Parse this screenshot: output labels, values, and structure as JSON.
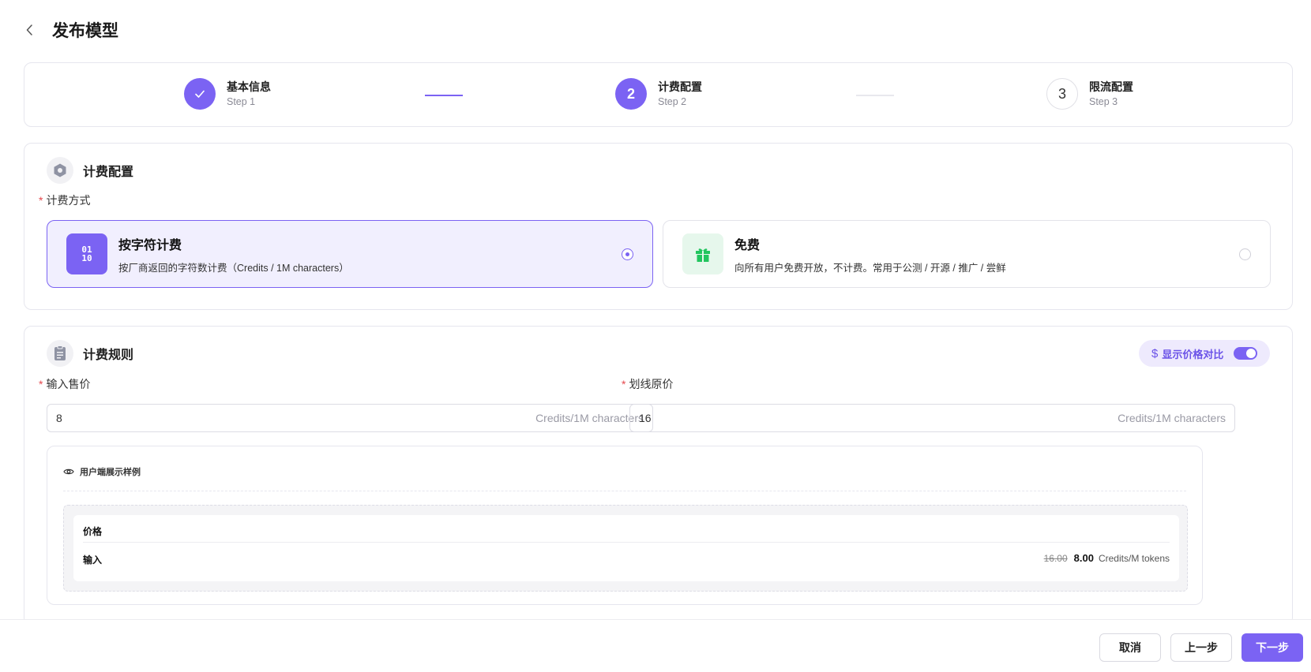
{
  "header": {
    "title": "发布模型"
  },
  "steps": [
    {
      "title": "基本信息",
      "sub": "Step 1",
      "state": "done"
    },
    {
      "title": "计费配置",
      "sub": "Step 2",
      "number": "2",
      "state": "active"
    },
    {
      "title": "限流配置",
      "sub": "Step 3",
      "number": "3",
      "state": "todo"
    }
  ],
  "billing": {
    "section_title": "计费配置",
    "method_label": "计费方式",
    "options": [
      {
        "icon_text": "01 10",
        "title": "按字符计费",
        "desc": "按厂商返回的字符数计费（Credits / 1M characters）",
        "selected": true
      },
      {
        "title": "免费",
        "desc": "向所有用户免费开放，不计费。常用于公测 / 开源 / 推广 / 尝鲜",
        "selected": false
      }
    ]
  },
  "rules": {
    "section_title": "计费规则",
    "toggle_label": "显示价格对比",
    "toggle_on": true,
    "input_price": {
      "label": "输入售价",
      "value": "8",
      "unit": "Credits/1M characters"
    },
    "original_price": {
      "label": "划线原价",
      "value": "16",
      "unit": "Credits/1M characters"
    },
    "preview": {
      "title": "用户端展示样例",
      "price_label": "价格",
      "row_label": "输入",
      "original": "16.00",
      "current": "8.00",
      "unit": "Credits/M tokens"
    }
  },
  "footer": {
    "cancel": "取消",
    "prev": "上一步",
    "next": "下一步"
  },
  "colors": {
    "accent": "#7b63f3",
    "success": "#22c55e",
    "required": "#e5484d"
  }
}
